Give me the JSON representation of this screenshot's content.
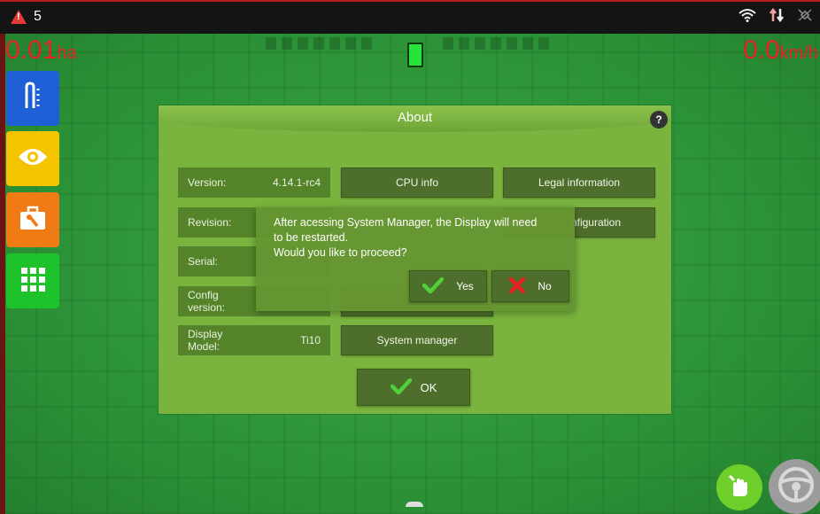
{
  "statusbar": {
    "alert_count": "5"
  },
  "readouts": {
    "area_value": "0.01",
    "area_unit": "ha",
    "speed_value": "0.0",
    "speed_unit": "km/h"
  },
  "about": {
    "title": "About",
    "help": "?",
    "version_label": "Version:",
    "version_value": "4.14.1-rc4",
    "revision_label": "Revision:",
    "serial_label": "Serial:",
    "config_label_1": "Config",
    "config_label_2": "version:",
    "model_label_1": "Display",
    "model_label_2": "Model:",
    "model_value": "Ti10",
    "cpu_info": "CPU info",
    "legal": "Legal information",
    "configuration_partial": "nfiguration",
    "system_manager": "System manager",
    "ok": "OK"
  },
  "confirm": {
    "message_line1": "After acessing System Manager, the Display will need",
    "message_line2": "to be restarted.",
    "message_line3": "Would you like to proceed?",
    "yes": "Yes",
    "no": "No"
  },
  "colors": {
    "alert_red": "#e52222",
    "sidebar_blue": "#1f5fd6",
    "sidebar_yellow": "#f5c400",
    "sidebar_orange": "#f07a13",
    "sidebar_green": "#1ec22b",
    "dialog_green": "#7ab43e"
  },
  "icons": [
    "warning-icon",
    "wifi-icon",
    "transfer-icon",
    "satellite-icon",
    "implement-icon",
    "eye-icon",
    "toolbox-icon",
    "apps-grid-icon",
    "check-icon",
    "x-icon",
    "hand-wrench-icon",
    "steering-wheel-icon"
  ]
}
